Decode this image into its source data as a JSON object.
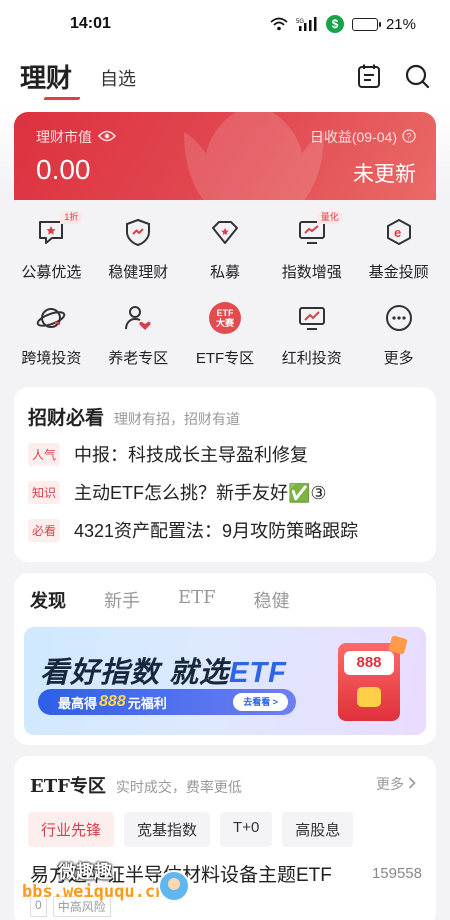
{
  "status_bar": {
    "time": "14:01",
    "network": "5G",
    "battery": "21%"
  },
  "header": {
    "title": "理财",
    "tab_watchlist": "自选",
    "icons": [
      "calendar-list-icon",
      "search-icon"
    ]
  },
  "asset_card": {
    "label": "理财市值",
    "value": "0.00",
    "date_label": "日收益(09-04)",
    "status": "未更新"
  },
  "quick_grid": {
    "items": [
      {
        "label": "公募优选",
        "badge": "1折",
        "icon": "speech-bubble-icon"
      },
      {
        "label": "稳健理财",
        "icon": "shield-icon"
      },
      {
        "label": "私募",
        "icon": "diamond-icon"
      },
      {
        "label": "指数增强",
        "badge": "量化",
        "icon": "monitor-chart-icon"
      },
      {
        "label": "基金投顾",
        "icon": "hexagon-e-icon"
      },
      {
        "label": "跨境投资",
        "icon": "planet-icon"
      },
      {
        "label": "养老专区",
        "icon": "person-heart-icon"
      },
      {
        "label": "ETF专区",
        "badge_lines": [
          "ETF",
          "大赛"
        ],
        "icon": "etf-badge-icon"
      },
      {
        "label": "红利投资",
        "icon": "monitor-trend-icon"
      },
      {
        "label": "更多",
        "icon": "more-dots-icon"
      }
    ]
  },
  "tips": {
    "title": "招财必看",
    "subtitle": "理财有招，招财有道",
    "rows": [
      {
        "tag": "人气",
        "text": "中报：科技成长主导盈利修复"
      },
      {
        "tag": "知识",
        "text": "主动ETF怎么挑？新手友好✅③"
      },
      {
        "tag": "必看",
        "text": "4321资产配置法：9月攻防策略跟踪"
      }
    ]
  },
  "discover": {
    "tabs": [
      "发现",
      "新手",
      "ETF",
      "稳健"
    ],
    "banner": {
      "title_part1": "看好指数 就选",
      "title_part2": "ETF",
      "bar_prefix": "最高得",
      "bar_number": "888",
      "bar_suffix": "元福利",
      "button": "去看看 >",
      "packet_number": "888"
    }
  },
  "etf_zone": {
    "title": "ETF专区",
    "subtitle": "实时成交，费率更低",
    "more": "更多",
    "chips": [
      "行业先锋",
      "宽基指数",
      "T+0",
      "高股息"
    ],
    "fund": {
      "name": "易方达中证半导体材料设备主题ETF",
      "code": "159558",
      "tags": [
        "0",
        "中高风险"
      ]
    }
  },
  "watermark": {
    "title": "微趣趣",
    "url": "bbs.weiququ.cn"
  },
  "colors": {
    "accent": "#d9414a",
    "card_red": "#e24a52",
    "etf_blue": "#2e64e6"
  }
}
